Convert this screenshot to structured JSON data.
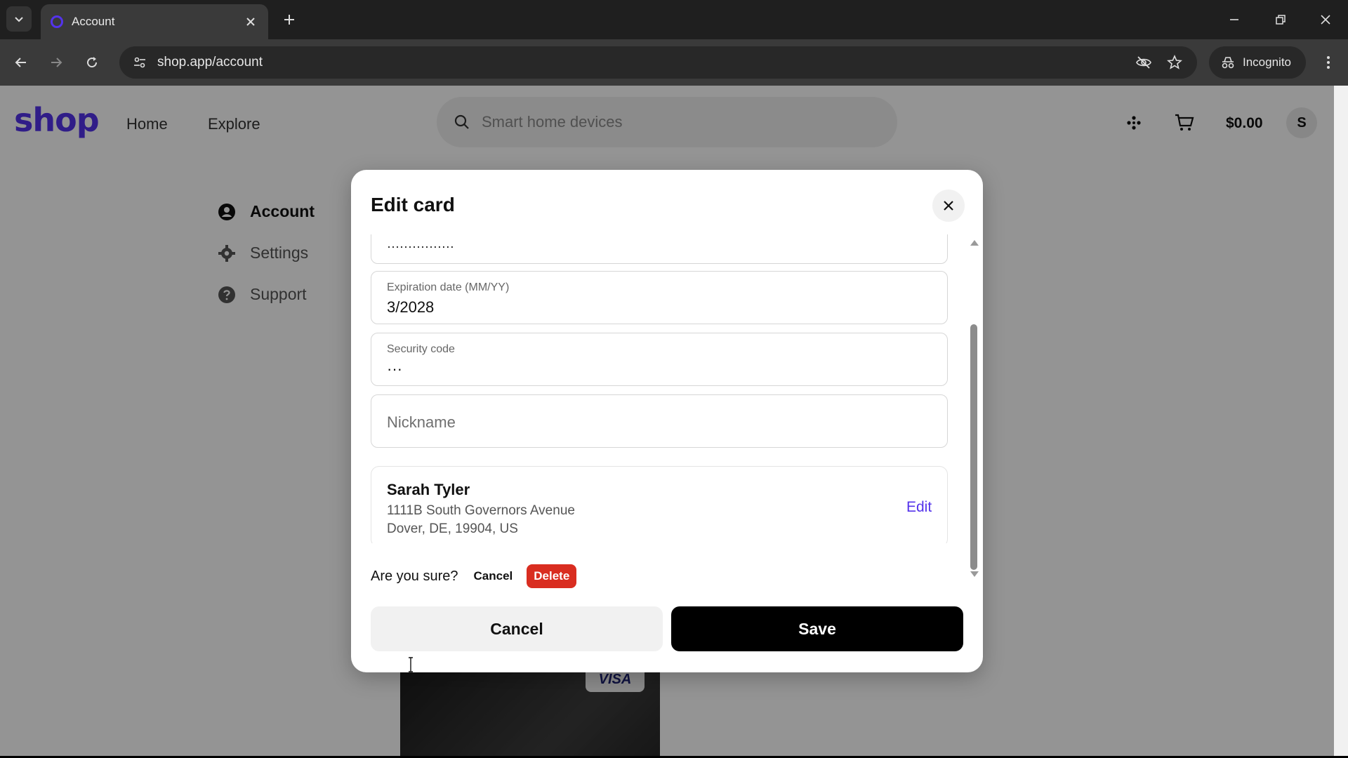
{
  "browser": {
    "tab_title": "Account",
    "url": "shop.app/account",
    "incognito_label": "Incognito"
  },
  "header": {
    "logo": "shop",
    "nav": [
      {
        "label": "Home"
      },
      {
        "label": "Explore"
      }
    ],
    "search_placeholder": "Smart home devices",
    "cart_total": "$0.00",
    "avatar_initial": "S"
  },
  "sidebar": {
    "items": [
      {
        "label": "Account",
        "icon": "user-circle-icon",
        "active": true
      },
      {
        "label": "Settings",
        "icon": "gear-icon"
      },
      {
        "label": "Support",
        "icon": "help-circle-icon"
      }
    ]
  },
  "card_preview": {
    "brand": "VISA"
  },
  "modal": {
    "title": "Edit card",
    "fields": {
      "card_number_value": "················",
      "expiration_label": "Expiration date (MM/YY)",
      "expiration_value": "3/2028",
      "security_label": "Security code",
      "security_value": "···",
      "nickname_placeholder": "Nickname"
    },
    "address": {
      "name": "Sarah Tyler",
      "line1": "1111B South Governors Avenue",
      "line2": "Dover, DE, 19904, US",
      "edit_label": "Edit"
    },
    "confirm": {
      "question": "Are you sure?",
      "cancel_label": "Cancel",
      "delete_label": "Delete"
    },
    "cancel_label": "Cancel",
    "save_label": "Save"
  },
  "colors": {
    "brand": "#5433eb",
    "danger": "#d92d20",
    "primary_button": "#000000"
  }
}
